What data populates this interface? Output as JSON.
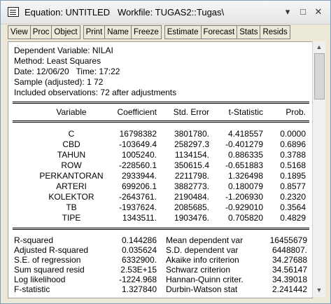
{
  "window": {
    "title": "Equation: UNTITLED   Workfile: TUGAS2::Tugas\\",
    "minimize_glyph": "▾",
    "restore_glyph": "□",
    "close_glyph": "✕"
  },
  "toolbar": {
    "buttons": [
      "View",
      "Proc",
      "Object",
      "Print",
      "Name",
      "Freeze",
      "Estimate",
      "Forecast",
      "Stats",
      "Resids"
    ]
  },
  "output": {
    "header": [
      "Dependent Variable: NILAI",
      "Method: Least Squares",
      "Date: 12/06/20   Time: 17:22",
      "Sample (adjusted): 1 72",
      "Included observations: 72 after adjustments"
    ],
    "columns": [
      "Variable",
      "Coefficient",
      "Std. Error",
      "t-Statistic",
      "Prob."
    ],
    "rows": [
      [
        "C",
        "16798382",
        "3801780.",
        "4.418557",
        "0.0000"
      ],
      [
        "CBD",
        "-103649.4",
        "258297.3",
        "-0.401279",
        "0.6896"
      ],
      [
        "TAHUN",
        "1005240.",
        "1134154.",
        "0.886335",
        "0.3788"
      ],
      [
        "ROW",
        "-228560.1",
        "350615.4",
        "-0.651883",
        "0.5168"
      ],
      [
        "PERKANTORAN",
        "2933944.",
        "2211798.",
        "1.326498",
        "0.1895"
      ],
      [
        "ARTERI",
        "699206.1",
        "3882773.",
        "0.180079",
        "0.8577"
      ],
      [
        "KOLEKTOR",
        "-2643761.",
        "2190484.",
        "-1.206930",
        "0.2320"
      ],
      [
        "TB",
        "-1937624.",
        "2085685.",
        "-0.929010",
        "0.3564"
      ],
      [
        "TIPE",
        "1343511.",
        "1903476.",
        "0.705820",
        "0.4829"
      ]
    ],
    "stats": [
      [
        "R-squared",
        "0.144286",
        "Mean dependent var",
        "16455679"
      ],
      [
        "Adjusted R-squared",
        "0.035624",
        "S.D. dependent var",
        "6448807."
      ],
      [
        "S.E. of regression",
        "6332900.",
        "Akaike info criterion",
        "34.27688"
      ],
      [
        "Sum squared resid",
        "2.53E+15",
        "Schwarz criterion",
        "34.56147"
      ],
      [
        "Log likelihood",
        "-1224.968",
        "Hannan-Quinn criter.",
        "34.39018"
      ],
      [
        "F-statistic",
        "1.327840",
        "Durbin-Watson stat",
        "2.241442"
      ]
    ]
  },
  "scrollbar": {
    "up_glyph": "▲",
    "down_glyph": "▼"
  }
}
